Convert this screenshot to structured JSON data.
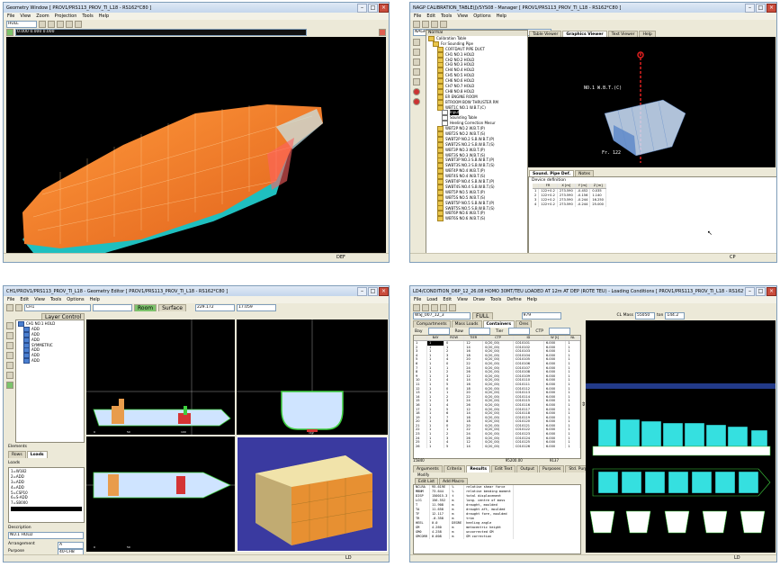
{
  "geometry_window": {
    "title": "Geometry Window [ PROV1/PRS113_PROV_TI_L18 - RS162*C80 ]",
    "menu": [
      "File",
      "View",
      "Zoom",
      "Projection",
      "Tools",
      "Help"
    ],
    "combo_value": "HULL",
    "coords": "0.000  0.000  0.000",
    "status": "DEF"
  },
  "manager_window": {
    "title": "NAGP CALIBRATION_TABLE(J)/SYS08 - Manager [ PROV1/PRS113_PROV_TI_L18 - RS162*C80 ]",
    "menu": [
      "File",
      "Edit",
      "Tools",
      "View",
      "Options",
      "Help"
    ],
    "address": "NAGP:CALIBRATION_TABLE(J)/SYS08",
    "tree_header": "Normal",
    "tree_items": [
      {
        "label": "Calibration Table",
        "level": 0,
        "selected": false
      },
      {
        "label": "For Sounding Pipe",
        "level": 1,
        "selected": false
      },
      {
        "label": "COFFDAUT PIPE DUCT",
        "level": 2,
        "selected": false
      },
      {
        "label": "CH1 NO.1 HOLD",
        "level": 2,
        "selected": false
      },
      {
        "label": "CH2 NO.2 HOLD",
        "level": 2,
        "selected": false
      },
      {
        "label": "CH3 NO.3 HOLD",
        "level": 2,
        "selected": false
      },
      {
        "label": "CH4 NO.4 HOLD",
        "level": 2,
        "selected": false
      },
      {
        "label": "CH5 NO.5 HOLD",
        "level": 2,
        "selected": false
      },
      {
        "label": "CH6 NO.6 HOLD",
        "level": 2,
        "selected": false
      },
      {
        "label": "CH7 NO.7 HOLD",
        "level": 2,
        "selected": false
      },
      {
        "label": "CH8 NO.8 HOLD",
        "level": 2,
        "selected": false
      },
      {
        "label": "ER ENGINE ROOM",
        "level": 2,
        "selected": false
      },
      {
        "label": "BTROOM BOW THRUSTER RM",
        "level": 2,
        "selected": false
      },
      {
        "label": "WBT1C NO.1 W.B.T.(C)",
        "level": 2,
        "selected": false
      },
      {
        "label": "Input",
        "level": 3,
        "selected": true
      },
      {
        "label": "Sounding Table",
        "level": 3,
        "selected": false
      },
      {
        "label": "Heeling Correction Mesur",
        "level": 3,
        "selected": false
      },
      {
        "label": "WBT2P NO.2 W.B.T.(P)",
        "level": 2,
        "selected": false
      },
      {
        "label": "WBT2S NO.2 W.B.T.(S)",
        "level": 2,
        "selected": false
      },
      {
        "label": "SWBT2P NO.2 S.B.W.B.T.(P)",
        "level": 2,
        "selected": false
      },
      {
        "label": "SWBT2S NO.2 S.B.W.B.T.(S)",
        "level": 2,
        "selected": false
      },
      {
        "label": "WBT3P NO.3 W.B.T.(P)",
        "level": 2,
        "selected": false
      },
      {
        "label": "WBT3S NO.3 W.B.T.(S)",
        "level": 2,
        "selected": false
      },
      {
        "label": "SWBT3P NO.3 S.B.W.B.T.(P)",
        "level": 2,
        "selected": false
      },
      {
        "label": "SWBT3S NO.3 S.B.W.B.T.(S)",
        "level": 2,
        "selected": false
      },
      {
        "label": "WBT4P NO.4 W.B.T.(P)",
        "level": 2,
        "selected": false
      },
      {
        "label": "WBT4S NO.4 W.B.T.(S)",
        "level": 2,
        "selected": false
      },
      {
        "label": "SWBT4P NO.4 S.B.W.B.T.(P)",
        "level": 2,
        "selected": false
      },
      {
        "label": "SWBT4S NO.4 S.B.W.B.T.(S)",
        "level": 2,
        "selected": false
      },
      {
        "label": "WBT5P NO.5 W.B.T.(P)",
        "level": 2,
        "selected": false
      },
      {
        "label": "WBT5S NO.5 W.B.T.(S)",
        "level": 2,
        "selected": false
      },
      {
        "label": "SWBT5P NO.5 S.B.W.B.T.(P)",
        "level": 2,
        "selected": false
      },
      {
        "label": "SWBT5S NO.5 S.B.W.B.T.(S)",
        "level": 2,
        "selected": false
      },
      {
        "label": "WBT6P NO.6 W.B.T.(P)",
        "level": 2,
        "selected": false
      },
      {
        "label": "WBT6S NO.6 W.B.T.(S)",
        "level": 2,
        "selected": false
      }
    ],
    "view_tabs": [
      "Table Viewer",
      "Graphics Viewer",
      "Text Viewer",
      "Help"
    ],
    "active_view_tab": "Graphics Viewer",
    "graphics_label_1": "NO.1 W.B.T.(C)",
    "graphics_label_2": "Fr. 122",
    "lower_tabs": [
      "Sound. Pipe Def.",
      "Notes"
    ],
    "device_label": "Device definition",
    "device_columns": [
      "",
      "FR",
      "X [m]",
      "Y [m]",
      "Z [m]"
    ],
    "device_rows": [
      [
        "1",
        "122+0.2",
        "273.590",
        "-0.452",
        "0.035"
      ],
      [
        "2",
        "122+0.2",
        "273.590",
        "-0.156",
        "1.140"
      ],
      [
        "3",
        "122+0.2",
        "273.590",
        "-0.244",
        "16.250"
      ],
      [
        "4",
        "122+0.2",
        "273.590",
        "-0.244",
        "25.000"
      ]
    ],
    "status": "CP"
  },
  "geometry_editor": {
    "title": "CH1/PROV1/PRS113_PROV_TI_L18 - Geometry Editor [ PROV1/PRS113_PROV_TI_L18 - RS162*C80 ]",
    "menu": [
      "File",
      "Edit",
      "View",
      "Tools",
      "Options",
      "Help"
    ],
    "combo_value": "CH1",
    "mode_buttons": [
      "Room",
      "Surface"
    ],
    "coord_x": "229.172",
    "coord_y": "17.059",
    "layer_tab": "Layer Control",
    "layers": [
      "CH1 NO.1 HOLD",
      "ADD",
      "ADD",
      "ADD",
      "SYMMETRIC",
      "ADD",
      "ADD",
      "ADD"
    ],
    "elements_label": "Elements",
    "element_tabs": [
      "Rows",
      "Loads"
    ],
    "loads_label": "Loads",
    "loads": [
      "1=W182",
      "2=ADD",
      "3=ADD",
      "4=ADD",
      "5=CSP10",
      "6=S-ADD",
      "7=SB000"
    ],
    "description_label": "Description",
    "description": "NO.1 HOLD",
    "arrangement_label": "Arrangement",
    "arrangement_value": "A",
    "purpose_label": "Purpose",
    "purpose_value": "40-CH8",
    "axis_ticks": [
      "0",
      "50",
      "100",
      "112"
    ],
    "status": "LD"
  },
  "loading_window": {
    "title": "LD4/CONDITION_D6P_12_26.08 HOMO 30MT/TEU LOADED AT 12m AT DEP (ROTE TEU) - Loading Conditions [ PROV1/PRS113_PROV_TI_L18 - RS162*C80 ]",
    "menu": [
      "File",
      "Load",
      "Edit",
      "View",
      "Draw",
      "Tools",
      "Define",
      "Help"
    ],
    "cond_name": "WSJ_007_12_3",
    "cond_tag": "FULL",
    "cond_value": "979",
    "cl_mass_label": "CL Mass",
    "cl_mass_value": "55050",
    "cl_mass_unit": "ton",
    "cl_mass_extra": "144.2",
    "tabs": [
      "Compartments",
      "Mass Loads",
      "Containers",
      "Ores"
    ],
    "active_tab": "Containers",
    "filter_labels": [
      "Bay",
      "Row",
      "Tier",
      "CTP"
    ],
    "columns": [
      "",
      "BAY",
      "ROW",
      "TIER",
      "CTP",
      "ID",
      "W [t]",
      "NL"
    ],
    "rows": [
      [
        "1",
        "1",
        "0",
        "12",
        "0(20_00)",
        "C010101",
        "6.000",
        "1"
      ],
      [
        "2",
        "1",
        "1",
        "14",
        "0(20_00)",
        "C010102",
        "6.000",
        "1"
      ],
      [
        "3",
        "1",
        "2",
        "16",
        "0(20_00)",
        "C010103",
        "6.000",
        "1"
      ],
      [
        "4",
        "1",
        "3",
        "18",
        "0(20_00)",
        "C010104",
        "6.000",
        "1"
      ],
      [
        "5",
        "1",
        "4",
        "20",
        "0(20_00)",
        "C010105",
        "6.000",
        "1"
      ],
      [
        "6",
        "1",
        "0",
        "22",
        "0(20_00)",
        "C010106",
        "6.000",
        "1"
      ],
      [
        "7",
        "1",
        "1",
        "24",
        "0(20_00)",
        "C010107",
        "6.000",
        "1"
      ],
      [
        "8",
        "1",
        "2",
        "26",
        "0(20_00)",
        "C010108",
        "6.000",
        "1"
      ],
      [
        "9",
        "1",
        "3",
        "12",
        "0(20_00)",
        "C010109",
        "6.000",
        "1"
      ],
      [
        "10",
        "1",
        "4",
        "14",
        "0(20_00)",
        "C010110",
        "6.000",
        "1"
      ],
      [
        "11",
        "1",
        "5",
        "16",
        "0(20_00)",
        "C010111",
        "6.000",
        "1"
      ],
      [
        "12",
        "1",
        "0",
        "18",
        "0(20_00)",
        "C010112",
        "6.000",
        "1"
      ],
      [
        "13",
        "1",
        "1",
        "20",
        "0(20_00)",
        "C010113",
        "6.000",
        "1"
      ],
      [
        "14",
        "1",
        "2",
        "22",
        "0(20_00)",
        "C010114",
        "6.000",
        "1"
      ],
      [
        "15",
        "1",
        "3",
        "24",
        "0(20_00)",
        "C010115",
        "6.000",
        "1"
      ],
      [
        "16",
        "1",
        "4",
        "26",
        "0(20_00)",
        "C010116",
        "6.000",
        "1"
      ],
      [
        "17",
        "1",
        "5",
        "12",
        "0(20_00)",
        "C010117",
        "6.000",
        "1"
      ],
      [
        "18",
        "1",
        "6",
        "14",
        "0(20_00)",
        "C010118",
        "6.000",
        "1"
      ],
      [
        "19",
        "1",
        "7",
        "16",
        "0(20_00)",
        "C010119",
        "6.000",
        "1"
      ],
      [
        "20",
        "1",
        "8",
        "18",
        "0(20_00)",
        "C010120",
        "6.000",
        "1"
      ],
      [
        "21",
        "1",
        "0",
        "20",
        "0(20_00)",
        "C010121",
        "6.000",
        "1"
      ],
      [
        "22",
        "1",
        "1",
        "22",
        "0(20_00)",
        "C010122",
        "6.000",
        "1"
      ],
      [
        "23",
        "1",
        "2",
        "24",
        "0(20_00)",
        "C010123",
        "6.000",
        "1"
      ],
      [
        "24",
        "1",
        "3",
        "26",
        "0(20_00)",
        "C010124",
        "6.000",
        "1"
      ],
      [
        "25",
        "1",
        "4",
        "12",
        "0(20_00)",
        "C010125",
        "6.000",
        "1"
      ],
      [
        "26",
        "1",
        "5",
        "14",
        "0(20_00)",
        "C010126",
        "6.000",
        "1"
      ]
    ],
    "footer_count": "15840",
    "footer_total": "95200.00",
    "footer_extra": "9137",
    "result_tabs": [
      "Arguments",
      "Criteria",
      "Results",
      "Edit Text",
      "Output",
      "Purposes",
      "Std. Purposes",
      "Crit. Types"
    ],
    "active_result_tab": "Results",
    "modify_label": "Modify",
    "sub_tabs": [
      "Edit List",
      "Add Macro"
    ],
    "results": [
      [
        "NCLRA",
        "95.619E",
        "%",
        "relative shear force"
      ],
      [
        "MBNM",
        "73.644",
        "%",
        "relative bending moment"
      ],
      [
        "DISP",
        "150015.3",
        "t",
        "total displacement"
      ],
      [
        "LCG",
        "156.552",
        "m",
        "long. centre of mass"
      ],
      [
        "T",
        "11.908",
        "m",
        "draught, moulded"
      ],
      [
        "TA",
        "11.658",
        "m",
        "draught aft, moulded"
      ],
      [
        "TF",
        "12.117",
        "m",
        "draught fore, moulded"
      ],
      [
        "TR",
        "-0.358",
        "m",
        "trim"
      ],
      [
        "HEEL",
        "0.0",
        "DEGRE",
        "heeling angle"
      ],
      [
        "GM",
        "4.260",
        "m",
        "metacentric height"
      ],
      [
        "GM0",
        "4.258",
        "m",
        "uncorrected GM"
      ],
      [
        "GMCORR",
        "0.008",
        "m",
        "GM correction"
      ]
    ],
    "status": "LD"
  }
}
